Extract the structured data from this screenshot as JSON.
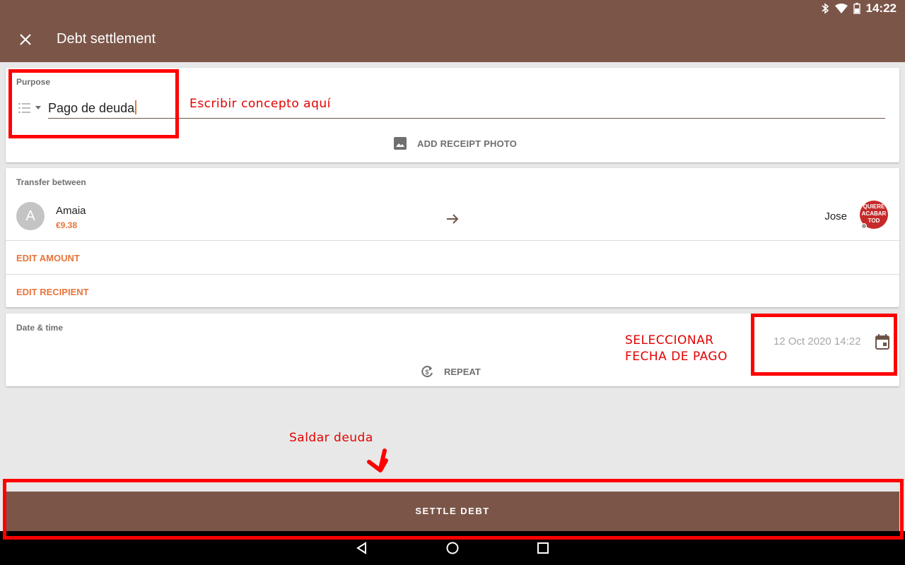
{
  "status_bar": {
    "time": "14:22",
    "icons": [
      "bluetooth-icon",
      "wifi-icon",
      "battery-icon"
    ]
  },
  "app_bar": {
    "title": "Debt settlement",
    "close_icon": "close-icon"
  },
  "purpose": {
    "label": "Purpose",
    "value": "Pago de deuda",
    "category_icon": "list-icon",
    "receipt_label": "ADD RECEIPT PHOTO"
  },
  "transfer": {
    "label": "Transfer between",
    "from": {
      "initial": "A",
      "name": "Amaia",
      "amount": "€9.38"
    },
    "to": {
      "name": "Jose",
      "avatar_text": "QUIERE ACABAR TOD"
    },
    "edit_amount": "EDIT AMOUNT",
    "edit_recipient": "EDIT RECIPIENT"
  },
  "date_time": {
    "label": "Date & time",
    "value": "12 Oct 2020 14:22",
    "repeat_label": "REPEAT"
  },
  "settle_button": "SETTLE DEBT",
  "annotations": {
    "purpose_note": "Escribir concepto aquí",
    "date_note_line1": "SELECCIONAR",
    "date_note_line2": "FECHA DE PAGO",
    "settle_note": "Saldar deuda"
  },
  "colors": {
    "primary": "#7b5648",
    "accent": "#e8743a",
    "annotation": "#ff0000"
  }
}
